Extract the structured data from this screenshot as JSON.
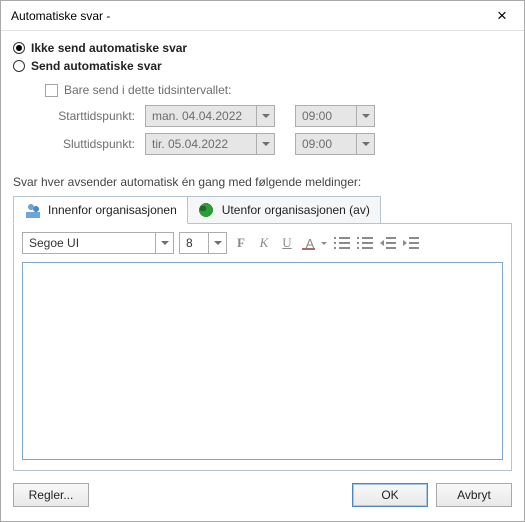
{
  "title": "Automatiske svar -",
  "radios": {
    "off_label": "Ikke send automatiske svar",
    "on_label": "Send automatiske svar"
  },
  "interval": {
    "checkbox_label": "Bare send i dette tidsintervallet:",
    "start_label": "Starttidspunkt:",
    "end_label": "Sluttidspunkt:",
    "start_date": "man. 04.04.2022",
    "start_time": "09:00",
    "end_date": "tir. 05.04.2022",
    "end_time": "09:00"
  },
  "reply_caption": "Svar hver avsender automatisk én gang med følgende meldinger:",
  "tabs": {
    "inside": "Innenfor organisasjonen",
    "outside": "Utenfor organisasjonen (av)"
  },
  "toolbar": {
    "font": "Segoe UI",
    "size": "8",
    "bold": "F",
    "italic": "K",
    "underline": "U",
    "color": "A"
  },
  "buttons": {
    "rules": "Regler...",
    "ok": "OK",
    "cancel": "Avbryt"
  }
}
